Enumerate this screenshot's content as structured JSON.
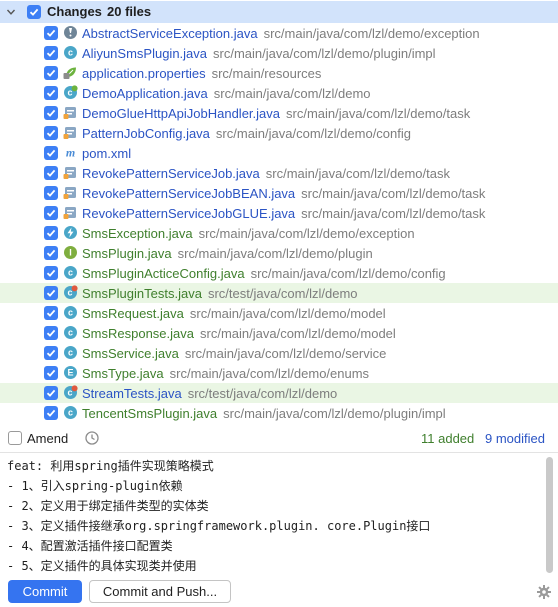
{
  "changes": {
    "title": "Changes",
    "count": "20 files",
    "files": [
      {
        "name": "AbstractServiceException.java",
        "path": "src/main/java/com/lzl/demo/exception",
        "icon": "exception-class-icon",
        "color": "blue"
      },
      {
        "name": "AliyunSmsPlugin.java",
        "path": "src/main/java/com/lzl/demo/plugin/impl",
        "icon": "class-icon",
        "color": "blue"
      },
      {
        "name": "application.properties",
        "path": "src/main/resources",
        "icon": "properties-leaf-icon",
        "color": "blue"
      },
      {
        "name": "DemoApplication.java",
        "path": "src/main/java/com/lzl/demo",
        "icon": "spring-app-class-icon",
        "color": "blue"
      },
      {
        "name": "DemoGlueHttpApiJobHandler.java",
        "path": "src/main/java/com/lzl/demo/task",
        "icon": "job-class-icon",
        "color": "blue"
      },
      {
        "name": "PatternJobConfig.java",
        "path": "src/main/java/com/lzl/demo/config",
        "icon": "job-class-icon",
        "color": "blue"
      },
      {
        "name": "pom.xml",
        "path": "",
        "icon": "maven-icon",
        "color": "blue"
      },
      {
        "name": "RevokePatternServiceJob.java",
        "path": "src/main/java/com/lzl/demo/task",
        "icon": "job-class-icon",
        "color": "blue"
      },
      {
        "name": "RevokePatternServiceJobBEAN.java",
        "path": "src/main/java/com/lzl/demo/task",
        "icon": "job-class-icon",
        "color": "blue"
      },
      {
        "name": "RevokePatternServiceJobGLUE.java",
        "path": "src/main/java/com/lzl/demo/task",
        "icon": "job-class-icon",
        "color": "blue"
      },
      {
        "name": "SmsException.java",
        "path": "src/main/java/com/lzl/demo/exception",
        "icon": "exception-icon",
        "color": "green"
      },
      {
        "name": "SmsPlugin.java",
        "path": "src/main/java/com/lzl/demo/plugin",
        "icon": "interface-icon",
        "color": "green"
      },
      {
        "name": "SmsPluginActiceConfig.java",
        "path": "src/main/java/com/lzl/demo/config",
        "icon": "class-icon",
        "color": "green"
      },
      {
        "name": "SmsPluginTests.java",
        "path": "src/test/java/com/lzl/demo",
        "icon": "test-class-icon",
        "color": "green",
        "highlight": true
      },
      {
        "name": "SmsRequest.java",
        "path": "src/main/java/com/lzl/demo/model",
        "icon": "class-icon",
        "color": "green"
      },
      {
        "name": "SmsResponse.java",
        "path": "src/main/java/com/lzl/demo/model",
        "icon": "class-icon",
        "color": "green"
      },
      {
        "name": "SmsService.java",
        "path": "src/main/java/com/lzl/demo/service",
        "icon": "class-icon",
        "color": "green"
      },
      {
        "name": "SmsType.java",
        "path": "src/main/java/com/lzl/demo/enums",
        "icon": "enum-icon",
        "color": "green"
      },
      {
        "name": "StreamTests.java",
        "path": "src/test/java/com/lzl/demo",
        "icon": "test-class-icon",
        "color": "blue",
        "highlight": true
      },
      {
        "name": "TencentSmsPlugin.java",
        "path": "src/main/java/com/lzl/demo/plugin/impl",
        "icon": "class-icon",
        "color": "green"
      }
    ]
  },
  "amend": {
    "label": "Amend"
  },
  "stats": {
    "added": "11 added",
    "modified": "9 modified"
  },
  "message_lines": [
    "feat: 利用spring插件实现策略模式",
    "- 1、引入spring-plugin依赖",
    "- 2、定义用于绑定插件类型的实体类",
    "- 3、定义插件接继承org.springframework.plugin. core.Plugin接口",
    "- 4、配置激活插件接口配置类",
    "- 5、定义插件的具体实现类并使用"
  ],
  "buttons": {
    "commit": "Commit",
    "commit_push": "Commit and Push..."
  },
  "colors": {
    "accent": "#3574f0",
    "added": "#3f7f2d",
    "modified": "#2b54c4",
    "selection": "#d2e3fb",
    "row_highlight": "#eaf6e4"
  }
}
